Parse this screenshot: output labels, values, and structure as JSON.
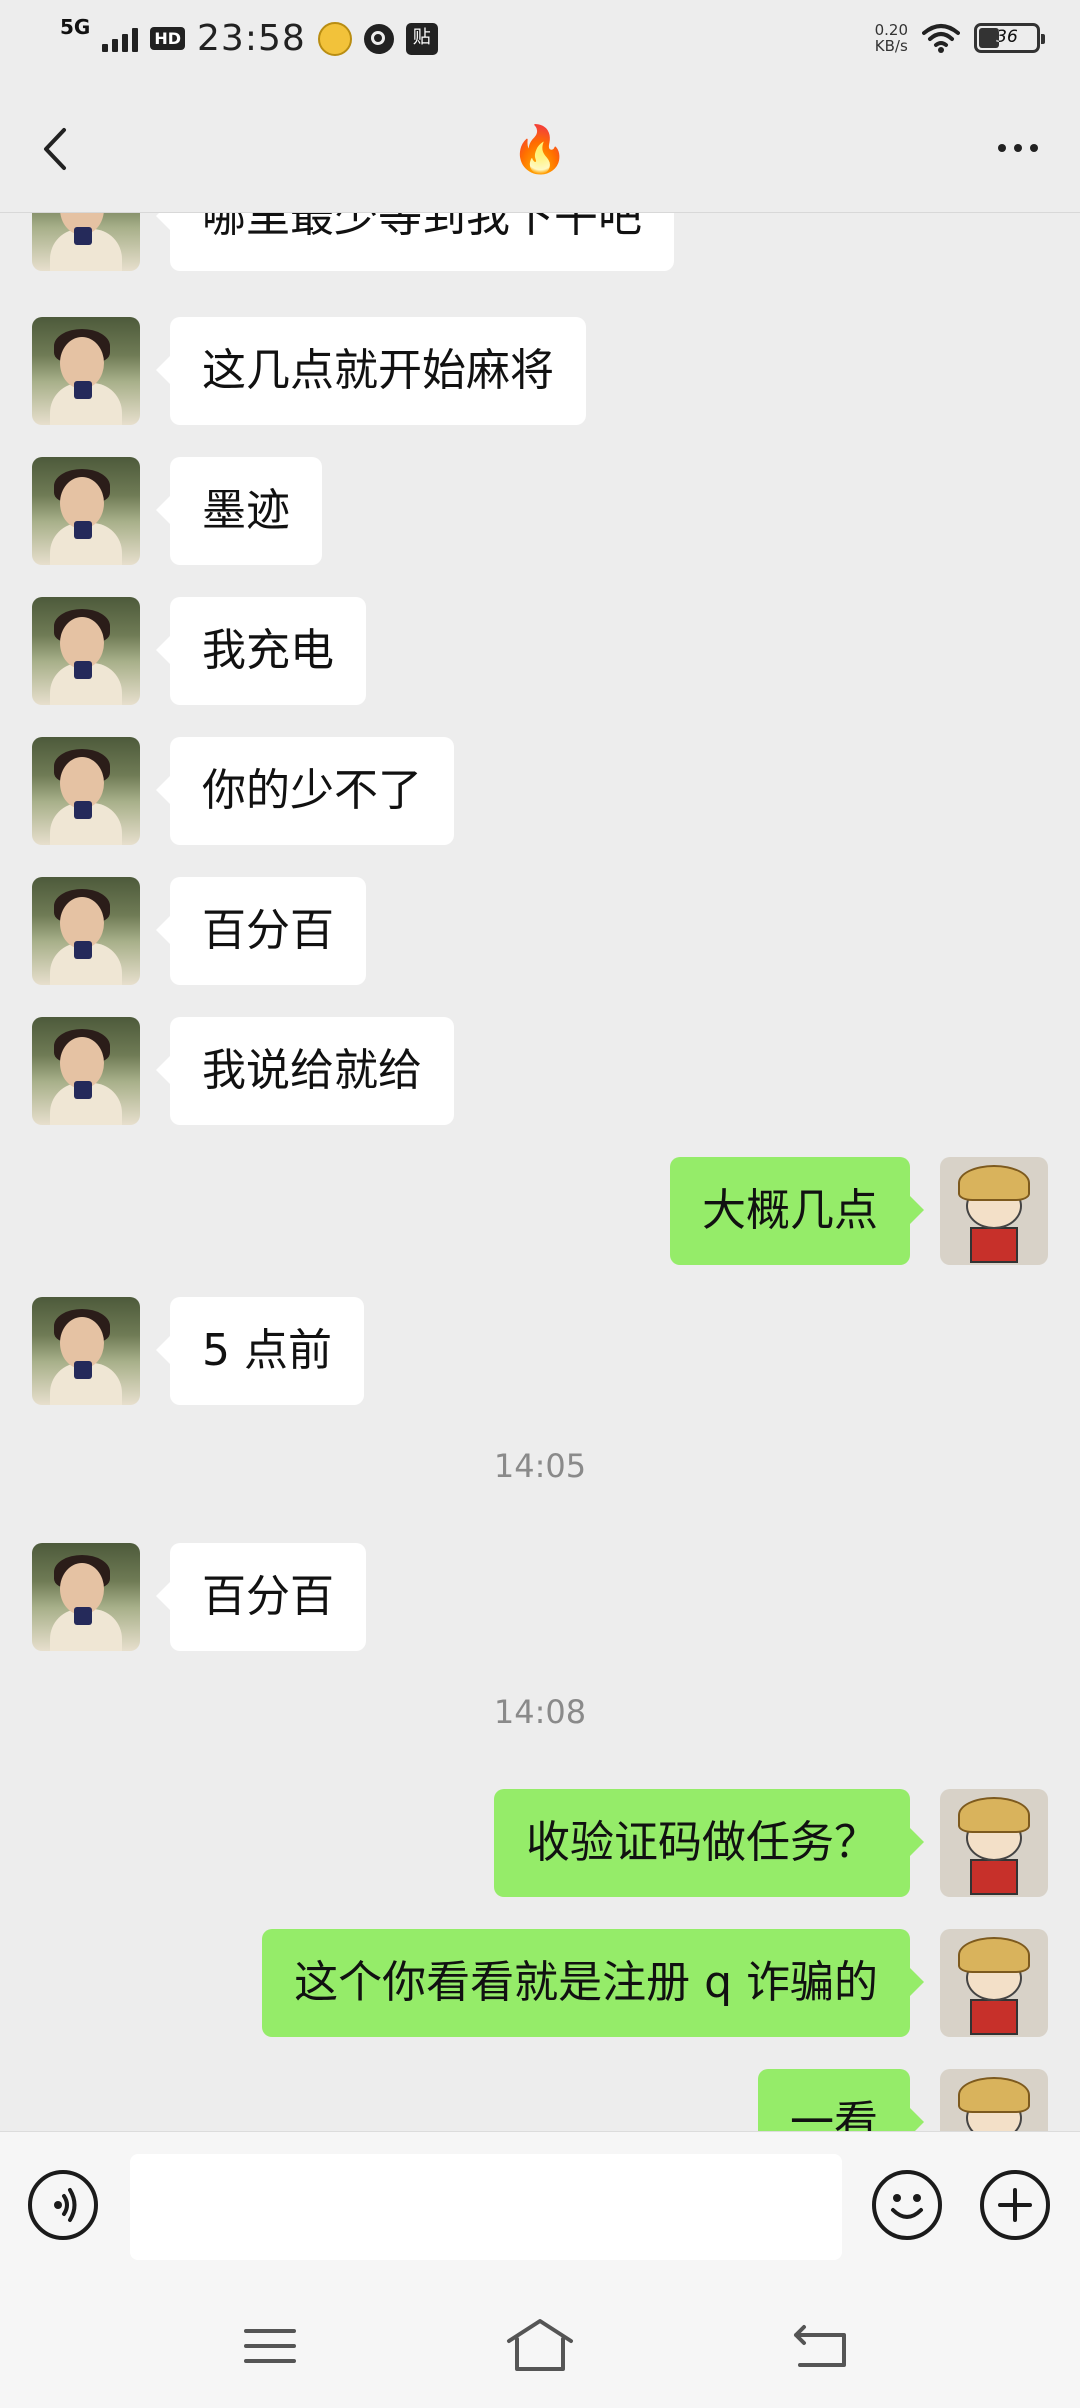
{
  "status_bar": {
    "network": "5G",
    "hd_badge": "HD",
    "time": "23:58",
    "net_speed_value": "0.20",
    "net_speed_unit": "KB/s",
    "battery_level": "36",
    "app_icons": [
      "face-app-icon",
      "q-app-icon",
      "tie-app-icon"
    ]
  },
  "header": {
    "title": "🔥",
    "back_icon": "chevron-left-icon",
    "more_icon": "more-dots-icon"
  },
  "messages": [
    {
      "side": "left",
      "text": "哪里最少等到我下午吧"
    },
    {
      "side": "left",
      "text": "这几点就开始麻将"
    },
    {
      "side": "left",
      "text": "墨迹"
    },
    {
      "side": "left",
      "text": "我充电"
    },
    {
      "side": "left",
      "text": "你的少不了"
    },
    {
      "side": "left",
      "text": "百分百"
    },
    {
      "side": "left",
      "text": "我说给就给"
    },
    {
      "side": "right",
      "text": "大概几点"
    },
    {
      "side": "left",
      "text": "5 点前"
    },
    {
      "type": "time",
      "text": "14:05"
    },
    {
      "side": "left",
      "text": "百分百"
    },
    {
      "type": "time",
      "text": "14:08"
    },
    {
      "side": "right",
      "text": "收验证码做任务？"
    },
    {
      "side": "right",
      "text": "这个你看看就是注册 q 诈骗的"
    },
    {
      "side": "right",
      "text": "一看"
    }
  ],
  "input_bar": {
    "voice_icon": "voice-icon",
    "text_value": "",
    "emoji_icon": "smiley-icon",
    "plus_icon": "plus-icon"
  },
  "nav_bar": {
    "menu_icon": "menu-icon",
    "home_icon": "home-icon",
    "back_icon": "back-arrow-icon"
  },
  "colors": {
    "background": "#ededed",
    "bubble_left": "#ffffff",
    "bubble_right": "#95ec69"
  }
}
